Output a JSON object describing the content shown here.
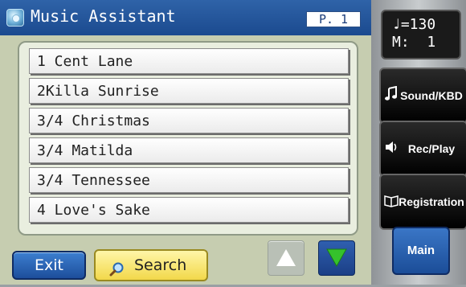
{
  "titlebar": {
    "title": "Music Assistant",
    "page": "P. 1"
  },
  "songs": [
    "1 Cent Lane",
    "2Killa Sunrise",
    "3/4 Christmas",
    "3/4 Matilda",
    "3/4 Tennessee",
    "4 Love's Sake"
  ],
  "buttons": {
    "exit": "Exit",
    "search": "Search",
    "up_icon": "triangle-up-icon",
    "down_icon": "triangle-down-icon"
  },
  "sidebar": {
    "tempo_line": "♩=130",
    "measure_line": "M:  1",
    "sound_kbd": "Sound/KBD",
    "rec_play": "Rec/Play",
    "registration": "Registration",
    "main": "Main"
  },
  "colors": {
    "accent_blue": "#1b4a8f",
    "search_yellow": "#f2d84a",
    "panel_green": "#c6cdb0"
  }
}
